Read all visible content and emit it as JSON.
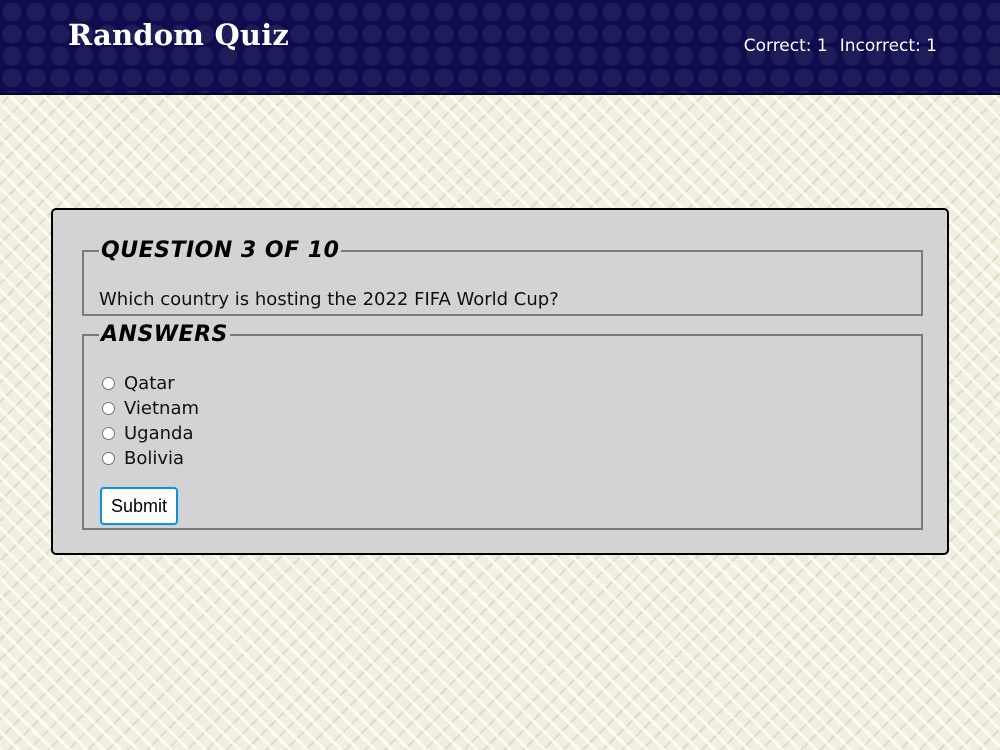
{
  "header": {
    "title": "Random Quiz",
    "correct_label": "Correct: 1",
    "incorrect_label": "Incorrect: 1"
  },
  "question": {
    "legend": "Question 3 of 10",
    "text": "Which country is hosting the 2022 FIFA World Cup?"
  },
  "answers": {
    "legend": "Answers",
    "options": [
      "Qatar",
      "Vietnam",
      "Uganda",
      "Bolivia"
    ],
    "submit_label": "Submit"
  },
  "colors": {
    "header_bg": "#0c0c4e",
    "card_bg": "#d3d3d3",
    "submit_border": "#1a8fd0"
  }
}
